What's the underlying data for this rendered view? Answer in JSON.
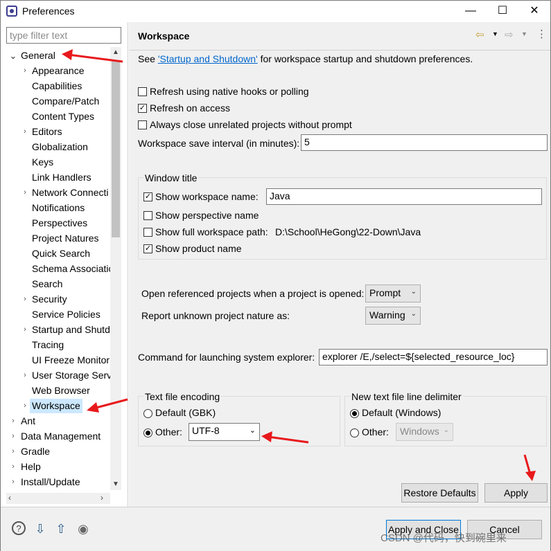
{
  "window": {
    "title": "Preferences",
    "minimize_label": "—",
    "maximize_label": "☐",
    "close_label": "✕"
  },
  "filter": {
    "placeholder": "type filter text"
  },
  "tree": {
    "general": {
      "label": "General",
      "twisty": "⌄"
    },
    "children": [
      {
        "label": "Appearance",
        "twisty": "›"
      },
      {
        "label": "Capabilities",
        "twisty": ""
      },
      {
        "label": "Compare/Patch",
        "twisty": ""
      },
      {
        "label": "Content Types",
        "twisty": ""
      },
      {
        "label": "Editors",
        "twisty": "›"
      },
      {
        "label": "Globalization",
        "twisty": ""
      },
      {
        "label": "Keys",
        "twisty": ""
      },
      {
        "label": "Link Handlers",
        "twisty": ""
      },
      {
        "label": "Network Connecti",
        "twisty": "›"
      },
      {
        "label": "Notifications",
        "twisty": ""
      },
      {
        "label": "Perspectives",
        "twisty": ""
      },
      {
        "label": "Project Natures",
        "twisty": ""
      },
      {
        "label": "Quick Search",
        "twisty": ""
      },
      {
        "label": "Schema Associatic",
        "twisty": ""
      },
      {
        "label": "Search",
        "twisty": ""
      },
      {
        "label": "Security",
        "twisty": "›"
      },
      {
        "label": "Service Policies",
        "twisty": ""
      },
      {
        "label": "Startup and Shutd",
        "twisty": "›"
      },
      {
        "label": "Tracing",
        "twisty": ""
      },
      {
        "label": "UI Freeze Monitor",
        "twisty": ""
      },
      {
        "label": "User Storage Serv",
        "twisty": "›"
      },
      {
        "label": "Web Browser",
        "twisty": ""
      },
      {
        "label": "Workspace",
        "twisty": "›"
      }
    ],
    "roots": [
      {
        "label": "Ant",
        "twisty": "›"
      },
      {
        "label": "Data Management",
        "twisty": "›"
      },
      {
        "label": "Gradle",
        "twisty": "›"
      },
      {
        "label": "Help",
        "twisty": "›"
      },
      {
        "label": "Install/Update",
        "twisty": "›"
      }
    ]
  },
  "page": {
    "title": "Workspace",
    "intro_before": "See ",
    "intro_link": "'Startup and Shutdown'",
    "intro_after": " for workspace startup and shutdown preferences.",
    "options": [
      {
        "label": "Refresh using native hooks or polling",
        "checked": false
      },
      {
        "label": "Refresh on access",
        "checked": true
      },
      {
        "label": "Always close unrelated projects without prompt",
        "checked": false
      }
    ],
    "save_interval_label": "Workspace save interval (in minutes):",
    "save_interval_value": "5",
    "window_title_group": "Window title",
    "show_workspace_name_label": "Show workspace name:",
    "show_workspace_name_checked": true,
    "workspace_name_value": "Java",
    "show_perspective_label": "Show perspective name",
    "show_perspective_checked": false,
    "show_full_path_label": "Show full workspace path:",
    "show_full_path_checked": false,
    "full_path_value": "D:\\School\\HeGong\\22-Down\\Java",
    "show_product_label": "Show product name",
    "show_product_checked": true,
    "open_referenced_label": "Open referenced projects when a project is opened:",
    "open_referenced_value": "Prompt",
    "report_nature_label": "Report unknown project nature as:",
    "report_nature_value": "Warning",
    "command_label": "Command for launching system explorer:",
    "command_value": "explorer /E,/select=${selected_resource_loc}",
    "encoding_group": "Text file encoding",
    "encoding_default_label": "Default (GBK)",
    "encoding_other_label": "Other:",
    "encoding_other_value": "UTF-8",
    "delimiter_group": "New text file line delimiter",
    "delimiter_default_label": "Default (Windows)",
    "delimiter_other_label": "Other:",
    "delimiter_other_value": "Windows",
    "restore_defaults_label": "Restore Defaults",
    "apply_label": "Apply"
  },
  "footer": {
    "apply_close_label": "Apply and Close",
    "cancel_label": "Cancel",
    "watermark": "CSDN @代码，快到碗里来"
  },
  "colors": {
    "selection": "#cce8ff",
    "arrow": "#e8191c",
    "link": "#0066cc",
    "dialog_bg": "#f0f0f0"
  }
}
